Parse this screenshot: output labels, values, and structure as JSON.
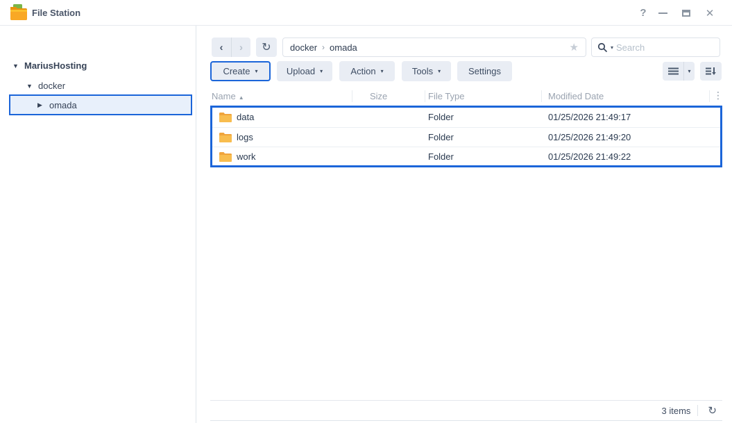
{
  "window": {
    "title": "File Station"
  },
  "icons": {
    "help": "?",
    "close": "✕",
    "back": "‹",
    "forward": "›",
    "refresh": "↻",
    "breadcrumb_separator": "›",
    "star": "★",
    "caret_down": "▾",
    "sort_asc": "▲",
    "ellipsis": "⋮",
    "tree_expanded": "▼",
    "tree_collapsed": "▶"
  },
  "sidebar": {
    "items": [
      {
        "label": "MariusHosting",
        "arrow": "▼",
        "state": "expanded"
      },
      {
        "label": "docker",
        "arrow": "▼",
        "state": "expanded"
      },
      {
        "label": "omada",
        "arrow": "▶",
        "state": "collapsed-selected"
      }
    ]
  },
  "toolbar": {
    "breadcrumb": {
      "segments": [
        "docker",
        "omada"
      ]
    },
    "search": {
      "placeholder": "Search"
    }
  },
  "actions": {
    "create": "Create",
    "upload": "Upload",
    "action": "Action",
    "tools": "Tools",
    "settings": "Settings"
  },
  "table": {
    "columns": {
      "name": "Name",
      "size": "Size",
      "file_type": "File Type",
      "modified": "Modified Date"
    },
    "sort": {
      "column": "Name",
      "direction": "asc"
    },
    "rows": [
      {
        "name": "data",
        "size": "",
        "file_type": "Folder",
        "modified": "01/25/2026 21:49:17"
      },
      {
        "name": "logs",
        "size": "",
        "file_type": "Folder",
        "modified": "01/25/2026 21:49:20"
      },
      {
        "name": "work",
        "size": "",
        "file_type": "Folder",
        "modified": "01/25/2026 21:49:22"
      }
    ]
  },
  "statusbar": {
    "items_count": "3 items"
  },
  "colors": {
    "accent": "#1b65d9",
    "selection_bg": "#e8f0fb",
    "button_bg": "#e9edf4",
    "folder_body": "#f8bd4f",
    "folder_tab": "#f0a43c"
  }
}
